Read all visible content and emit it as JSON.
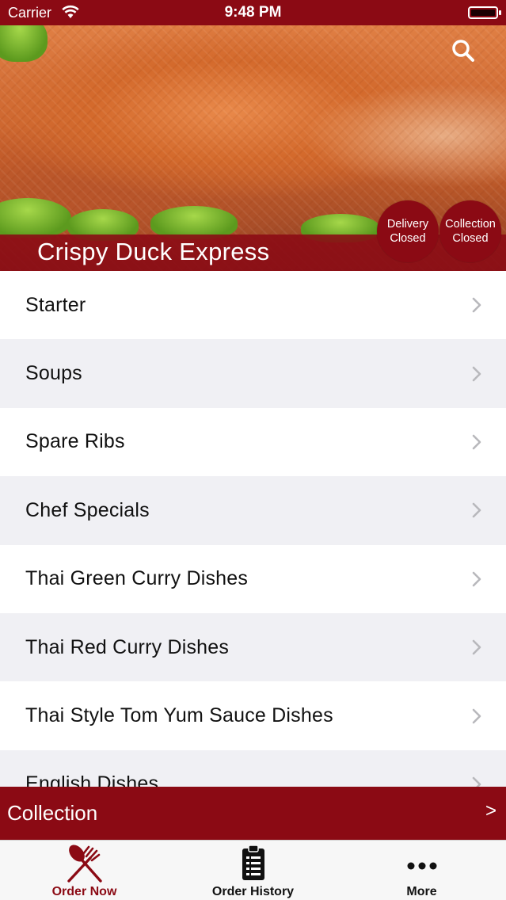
{
  "status_bar": {
    "carrier": "Carrier",
    "time": "9:48 PM"
  },
  "header": {
    "restaurant_name": "Crispy Duck Express",
    "search_icon": "search-icon",
    "delivery_status": {
      "line1": "Delivery",
      "line2": "Closed"
    },
    "collection_status": {
      "line1": "Collection",
      "line2": "Closed"
    }
  },
  "menu": {
    "items": [
      {
        "label": "Starter"
      },
      {
        "label": "Soups"
      },
      {
        "label": "Spare Ribs"
      },
      {
        "label": "Chef Specials"
      },
      {
        "label": "Thai Green Curry Dishes"
      },
      {
        "label": "Thai Red Curry Dishes"
      },
      {
        "label": "Thai Style Tom Yum Sauce Dishes"
      },
      {
        "label": "English Dishes"
      }
    ],
    "chevron_icon": "chevron-right-icon"
  },
  "order_mode_bar": {
    "label": "Collection",
    "arrow": ">"
  },
  "tabs": [
    {
      "label": "Order Now",
      "icon": "fork-knife-icon",
      "active": true
    },
    {
      "label": "Order History",
      "icon": "clipboard-list-icon",
      "active": false
    },
    {
      "label": "More",
      "icon": "more-dots-icon",
      "active": false
    }
  ],
  "colors": {
    "brand": "#8b0a14",
    "row_alt": "#f0f0f4",
    "tab_bg": "#f7f7f7"
  }
}
